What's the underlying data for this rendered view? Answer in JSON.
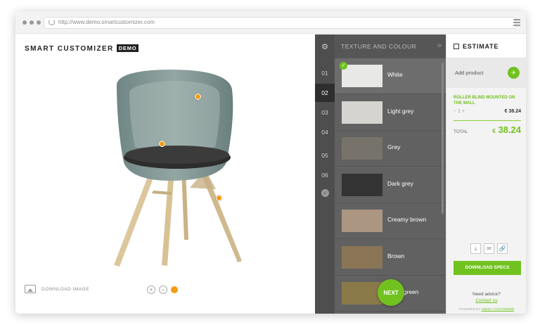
{
  "browser": {
    "url": "http://www.demo.smartcustomizer.com"
  },
  "brand": {
    "name": "SMART CUSTOMIZER",
    "badge": "DEMO"
  },
  "product": {
    "download_image_label": "DOWNLOAD IMAGE",
    "zoom_in": "+",
    "zoom_out": "−"
  },
  "steps": [
    "01",
    "02",
    "03",
    "04",
    "05",
    "06"
  ],
  "active_step": "02",
  "texture_panel": {
    "title": "TEXTURE AND COLOUR",
    "swatches": [
      {
        "name": "White",
        "color": "#e8e8e6"
      },
      {
        "name": "Light grey",
        "color": "#d5d4d0"
      },
      {
        "name": "Grey",
        "color": "#77736a"
      },
      {
        "name": "Dark grey",
        "color": "#333333"
      },
      {
        "name": "Creamy brown",
        "color": "#ab9682"
      },
      {
        "name": "Brown",
        "color": "#8a7657"
      },
      {
        "name": "Moss green",
        "color": "#8a7a4a"
      }
    ],
    "selected": "White"
  },
  "next_label": "NEXT",
  "estimate": {
    "title": "ESTIMATE",
    "add_product_label": "Add product",
    "add_icon": "+",
    "item_name": "ROLLER BLIND MOUNTED ON THE WALL",
    "item_qty": "1",
    "item_price": "€ 38.24",
    "total_label": "TOTAL",
    "total_currency": "€",
    "total_value": "38.24",
    "download_specs_label": "DOWNLOAD SPECS",
    "advice_text": "Need advice?",
    "contact_link": "Contact us",
    "powered_prefix": "POWERED BY",
    "powered_brand": "SMART CUSTOMIZER"
  },
  "colors": {
    "accent_green": "#71c21f",
    "hotspot_orange": "#f39c12"
  }
}
